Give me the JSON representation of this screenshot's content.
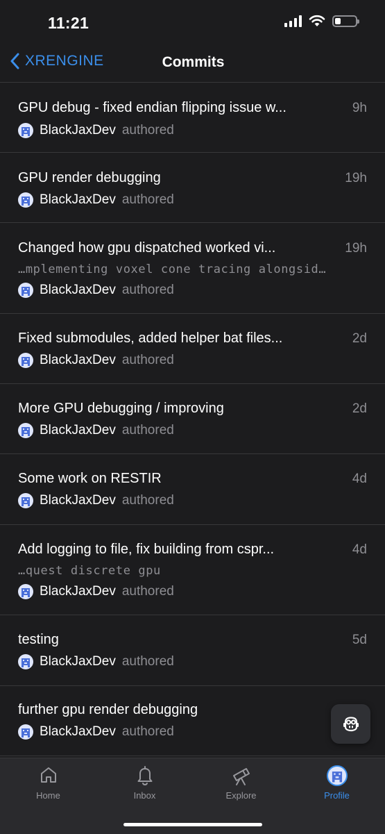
{
  "status": {
    "time": "11:21"
  },
  "nav": {
    "back_label": "XRENGINE",
    "title": "Commits"
  },
  "commits": [
    {
      "title": "GPU debug - fixed endian flipping issue w...",
      "time": "9h",
      "subtitle": "",
      "author": "BlackJaxDev",
      "action": "authored"
    },
    {
      "title": "GPU render debugging",
      "time": "19h",
      "subtitle": "",
      "author": "BlackJaxDev",
      "action": "authored"
    },
    {
      "title": "Changed how gpu dispatched worked vi...",
      "time": "19h",
      "subtitle": "…mplementing voxel cone tracing alongsid…",
      "author": "BlackJaxDev",
      "action": "authored"
    },
    {
      "title": "Fixed submodules, added helper bat files...",
      "time": "2d",
      "subtitle": "",
      "author": "BlackJaxDev",
      "action": "authored"
    },
    {
      "title": "More GPU debugging / improving",
      "time": "2d",
      "subtitle": "",
      "author": "BlackJaxDev",
      "action": "authored"
    },
    {
      "title": "Some work on RESTIR",
      "time": "4d",
      "subtitle": "",
      "author": "BlackJaxDev",
      "action": "authored"
    },
    {
      "title": "Add logging to file, fix building from cspr...",
      "time": "4d",
      "subtitle": "…quest discrete gpu",
      "author": "BlackJaxDev",
      "action": "authored"
    },
    {
      "title": "testing",
      "time": "5d",
      "subtitle": "",
      "author": "BlackJaxDev",
      "action": "authored"
    },
    {
      "title": "further gpu render debugging",
      "time": "",
      "subtitle": "",
      "author": "BlackJaxDev",
      "action": "authored"
    }
  ],
  "fab": {
    "icon": "copilot-icon"
  },
  "tabs": [
    {
      "label": "Home",
      "icon": "home-icon"
    },
    {
      "label": "Inbox",
      "icon": "bell-icon"
    },
    {
      "label": "Explore",
      "icon": "telescope-icon"
    },
    {
      "label": "Profile",
      "icon": "avatar",
      "active": true
    }
  ],
  "colors": {
    "background": "#1c1c1e",
    "accent": "#3b8eea",
    "secondary_text": "#8e8e93",
    "tab_bar": "#2a2a2d"
  }
}
